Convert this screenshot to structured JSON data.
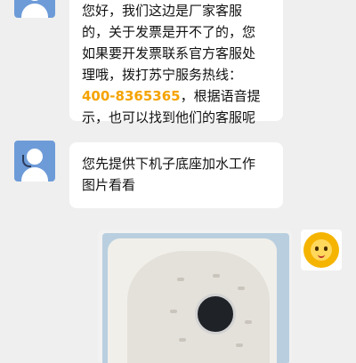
{
  "messages": [
    {
      "sender": "agent",
      "lines": [
        "您好，我们这边是厂家客服",
        "的，关于发票是开不了的，您",
        "如果要开发票联系官方客服处",
        "理哦，拨打苏宁服务热线：",
        "400-8365365",
        "，根据语音提",
        "示，也可以找到他们的客服呢"
      ]
    },
    {
      "sender": "agent",
      "lines": [
        "您先提供下机子底座加水工作",
        "图片看看"
      ]
    },
    {
      "sender": "user",
      "type": "image",
      "content": "photo-of-water-tank-base"
    }
  ],
  "colors": {
    "background": "#efefef",
    "hotline": "#f5a300",
    "agent_avatar": "#6d9bd8",
    "bot_avatar": "#f5b400"
  },
  "icons": {
    "agent_avatar": "customer-service-icon",
    "user_avatar": "suning-lion-icon"
  }
}
